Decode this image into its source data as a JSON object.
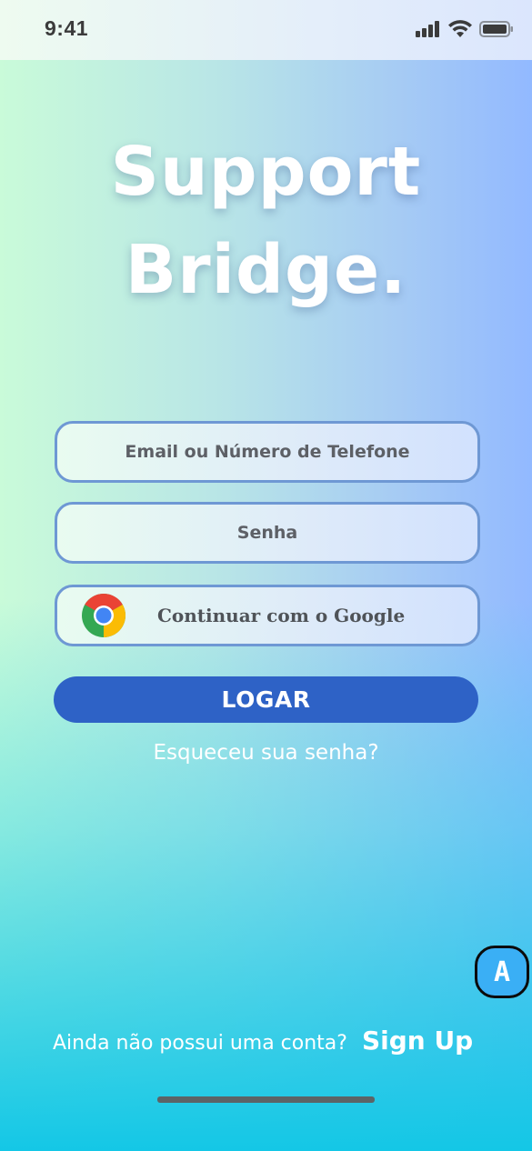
{
  "status_bar": {
    "time": "9:41"
  },
  "app": {
    "title_line1": "Support",
    "title_line2": "Bridge."
  },
  "form": {
    "email_placeholder": "Email ou Número de Telefone",
    "password_placeholder": "Senha",
    "google_label": "Continuar com o Google",
    "login_label": "LOGAR",
    "forgot_label": "Esqueceu sua senha?"
  },
  "footer": {
    "signup_prompt": "Ainda não possui uma conta?",
    "signup_link": "Sign Up"
  },
  "accessibility": {
    "badge_label": "A"
  },
  "icons": {
    "google": "chrome-logo-icon",
    "signal": "cellular-signal-icon",
    "wifi": "wifi-icon",
    "battery": "battery-icon"
  },
  "colors": {
    "primary_button": "#2e62c6",
    "field_border": "#6e98d4",
    "badge": "#3aaff5"
  }
}
